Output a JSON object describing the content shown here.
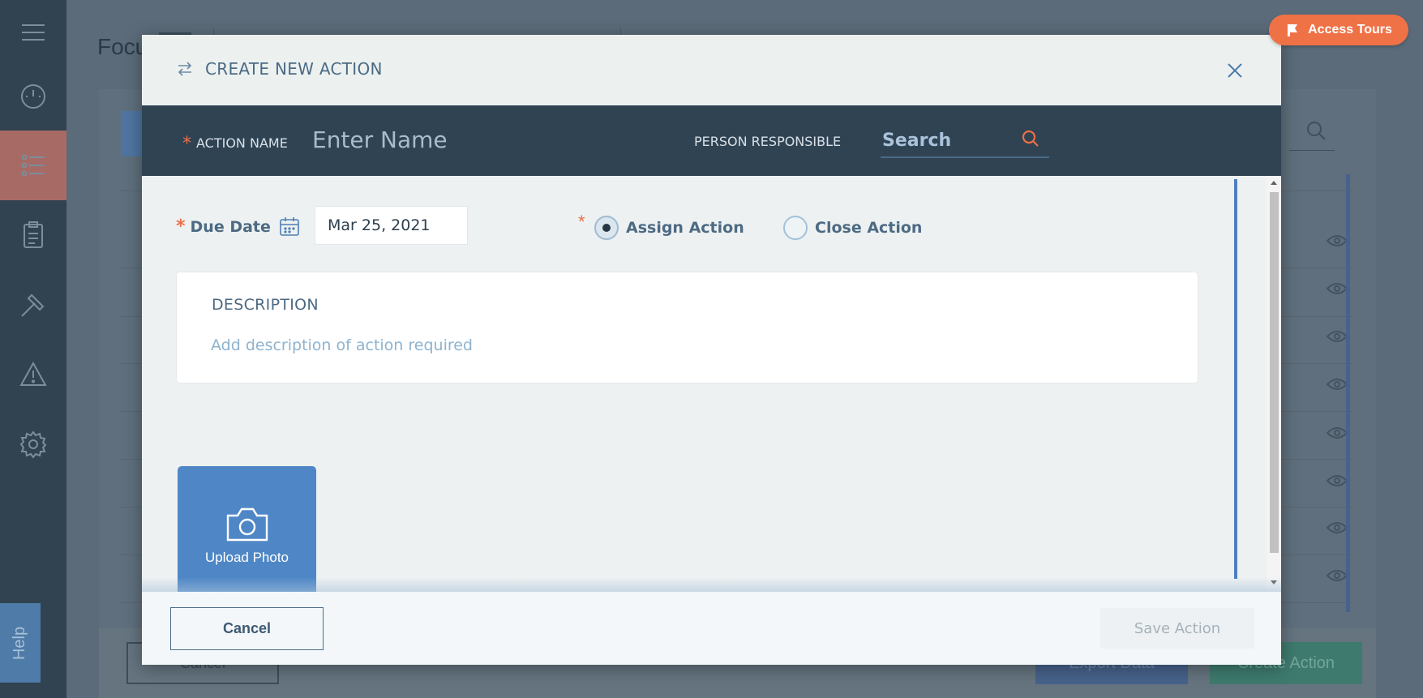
{
  "background": {
    "page_title": "Focu",
    "footer": {
      "cancel_label": "Cancel",
      "export_label": "Export Data",
      "create_label": "Create Action"
    },
    "help_label": "Help",
    "sidebar_icons": [
      "dashboard-icon",
      "list-icon",
      "clipboard-icon",
      "hammer-icon",
      "warning-icon",
      "gear-icon"
    ]
  },
  "access_tours": {
    "label": "Access Tours",
    "icon": "flag-icon",
    "color": "#ef7247"
  },
  "modal": {
    "title": "CREATE NEW ACTION",
    "title_icon": "swap-icon",
    "close_icon": "close-icon",
    "action_name": {
      "required_mark": "*",
      "label": "ACTION NAME",
      "placeholder": "Enter Name",
      "value": ""
    },
    "person_responsible": {
      "label": "PERSON RESPONSIBLE",
      "placeholder": "Search",
      "value": ""
    },
    "due_date": {
      "required_mark": "*",
      "label": "Due Date",
      "value": "Mar 25, 2021"
    },
    "action_type": {
      "required_mark": "*",
      "options": [
        {
          "label": "Assign Action",
          "selected": true
        },
        {
          "label": "Close Action",
          "selected": false
        }
      ]
    },
    "description": {
      "title": "DESCRIPTION",
      "placeholder": "Add description of action required",
      "value": ""
    },
    "upload": {
      "label": "Upload Photo",
      "icon": "camera-icon"
    },
    "footer": {
      "cancel_label": "Cancel",
      "save_label": "Save Action"
    }
  },
  "colors": {
    "accent_orange": "#ef7247",
    "header_dark": "#2f4353",
    "primary_blue": "#4f87c6"
  }
}
